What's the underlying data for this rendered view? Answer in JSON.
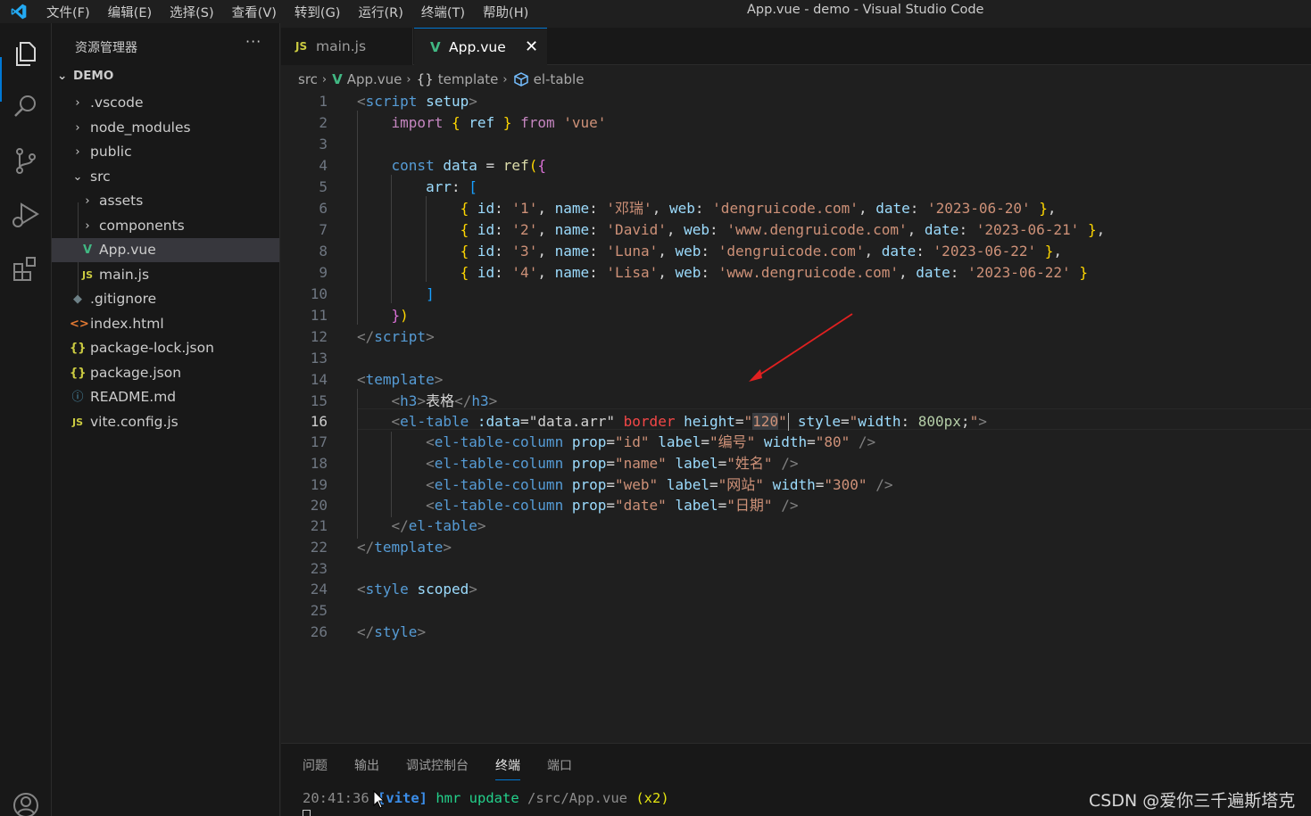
{
  "titlebar": {
    "menu": [
      "文件(F)",
      "编辑(E)",
      "选择(S)",
      "查看(V)",
      "转到(G)",
      "运行(R)",
      "终端(T)",
      "帮助(H)"
    ],
    "title": "App.vue - demo - Visual Studio Code"
  },
  "activitybar": {
    "icons": [
      "explorer-icon",
      "search-icon",
      "source-control-icon",
      "run-debug-icon",
      "extensions-icon",
      "account-icon"
    ]
  },
  "sidebar": {
    "title": "资源管理器",
    "more": "···",
    "root": "DEMO",
    "items": [
      {
        "label": ".vscode",
        "icon": "chevron-right"
      },
      {
        "label": "node_modules",
        "icon": "chevron-right"
      },
      {
        "label": "public",
        "icon": "chevron-right"
      },
      {
        "label": "src",
        "icon": "chevron-down"
      },
      {
        "label": "assets",
        "icon": "chevron-right"
      },
      {
        "label": "components",
        "icon": "chevron-right"
      },
      {
        "label": "App.vue",
        "icon": "vue-icon"
      },
      {
        "label": "main.js",
        "icon": "js-icon"
      },
      {
        "label": ".gitignore",
        "icon": "git-icon"
      },
      {
        "label": "index.html",
        "icon": "html-icon"
      },
      {
        "label": "package-lock.json",
        "icon": "json-icon"
      },
      {
        "label": "package.json",
        "icon": "json-icon"
      },
      {
        "label": "README.md",
        "icon": "info-icon"
      },
      {
        "label": "vite.config.js",
        "icon": "js-icon"
      }
    ]
  },
  "tabs": {
    "items": [
      {
        "label": "main.js",
        "icon": "JS"
      },
      {
        "label": "App.vue",
        "icon": "vue"
      }
    ],
    "close": "✕"
  },
  "breadcrumb": {
    "parts": [
      "src",
      "App.vue",
      "template",
      "el-table"
    ],
    "template_icon": "{}"
  },
  "editor": {
    "current_line": 16,
    "line_numbers": [
      "1",
      "2",
      "3",
      "4",
      "5",
      "6",
      "7",
      "8",
      "9",
      "10",
      "11",
      "12",
      "13",
      "14",
      "15",
      "16",
      "17",
      "18",
      "19",
      "20",
      "21",
      "22",
      "23",
      "24",
      "25",
      "26"
    ]
  },
  "panel": {
    "tabs": [
      "问题",
      "输出",
      "调试控制台",
      "终端",
      "端口"
    ],
    "active_tab": "终端",
    "terminal": {
      "time": "20:41:36",
      "tag": "[vite]",
      "message": "hmr update",
      "path": "/src/App.vue",
      "count": "(x2)"
    }
  },
  "watermark": "CSDN @爱你三千遍斯塔克",
  "colors": {
    "accent": "#0078d4",
    "vue_green": "#41b883",
    "js_yellow": "#cbcb41"
  }
}
